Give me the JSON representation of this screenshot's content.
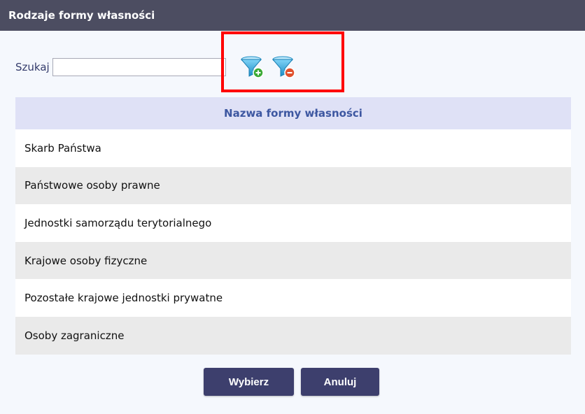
{
  "dialog": {
    "title": "Rodzaje formy własności"
  },
  "search": {
    "label": "Szukaj",
    "value": "",
    "placeholder": ""
  },
  "filters": {
    "add_icon": "filter-add-icon",
    "remove_icon": "filter-remove-icon"
  },
  "table": {
    "header": "Nazwa formy własności",
    "rows": [
      "Skarb Państwa",
      "Państwowe osoby prawne",
      "Jednostki samorządu terytorialnego",
      "Krajowe osoby fizyczne",
      "Pozostałe krajowe jednostki prywatne",
      "Osoby zagraniczne"
    ]
  },
  "buttons": {
    "select": "Wybierz",
    "cancel": "Anuluj"
  },
  "colors": {
    "titlebar": "#4c4d61",
    "header_text": "#3d57a1",
    "header_bg": "#dfe1f6",
    "button": "#3d3f6d",
    "highlight": "#ff0000",
    "filter_funnel": "#2a9fd6",
    "filter_add": "#3aa935",
    "filter_remove": "#e0502d"
  }
}
